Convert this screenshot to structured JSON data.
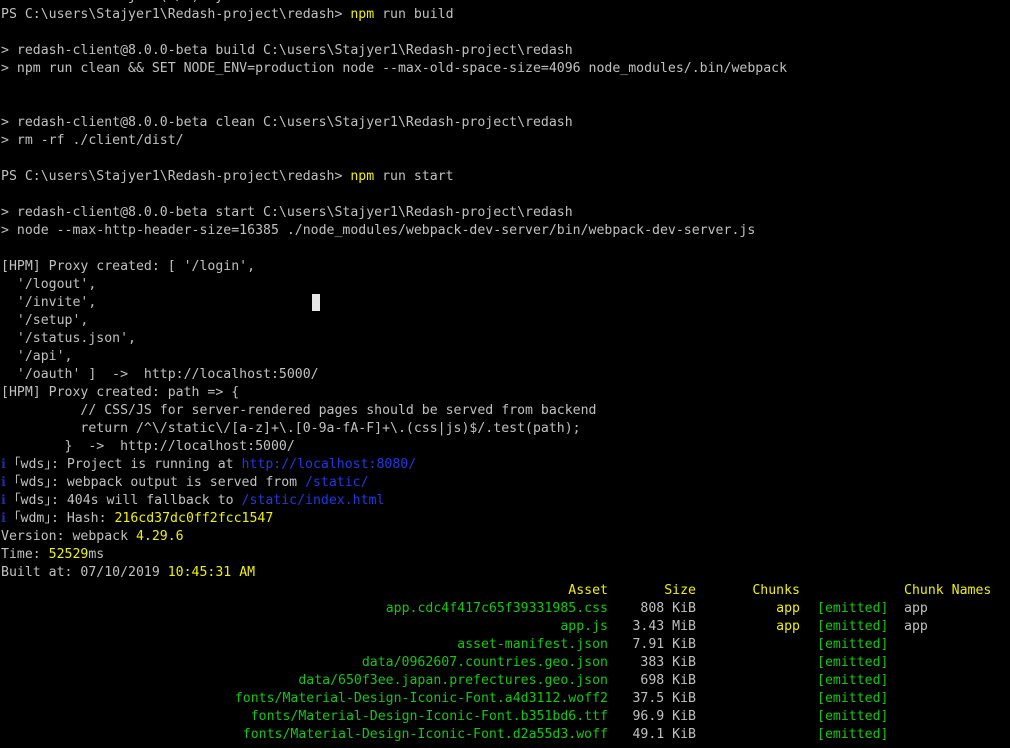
{
  "terminal": {
    "lines": [
      [
        {
          "t": "Terminate batch job (Y/N)? y",
          "c": "w"
        }
      ],
      [
        {
          "t": "PS C:\\users\\Stajyer1\\Redash-project\\redash> ",
          "c": "w"
        },
        {
          "t": "npm",
          "c": "y"
        },
        {
          "t": " run build",
          "c": "w"
        }
      ],
      [],
      [
        {
          "t": "> redash-client@8.0.0-beta build C:\\users\\Stajyer1\\Redash-project\\redash",
          "c": "w"
        }
      ],
      [
        {
          "t": "> npm run clean && SET NODE_ENV=production node --max-old-space-size=4096 node_modules/.bin/webpack",
          "c": "w"
        }
      ],
      [],
      [],
      [
        {
          "t": "> redash-client@8.0.0-beta clean C:\\users\\Stajyer1\\Redash-project\\redash",
          "c": "w"
        }
      ],
      [
        {
          "t": "> rm -rf ./client/dist/",
          "c": "w"
        }
      ],
      [],
      [
        {
          "t": "PS C:\\users\\Stajyer1\\Redash-project\\redash> ",
          "c": "w"
        },
        {
          "t": "npm",
          "c": "y"
        },
        {
          "t": " run start",
          "c": "w"
        }
      ],
      [],
      [
        {
          "t": "> redash-client@8.0.0-beta start C:\\users\\Stajyer1\\Redash-project\\redash",
          "c": "w"
        }
      ],
      [
        {
          "t": "> node --max-http-header-size=16385 ./node_modules/webpack-dev-server/bin/webpack-dev-server.js",
          "c": "w"
        }
      ],
      [],
      [
        {
          "t": "[HPM] Proxy created: [ '/login',",
          "c": "w"
        }
      ],
      [
        {
          "t": "  '/logout',",
          "c": "w"
        }
      ],
      [
        {
          "t": "  '/invite',",
          "c": "w"
        }
      ],
      [
        {
          "t": "  '/setup',",
          "c": "w"
        }
      ],
      [
        {
          "t": "  '/status.json',",
          "c": "w"
        }
      ],
      [
        {
          "t": "  '/api',",
          "c": "w"
        }
      ],
      [
        {
          "t": "  '/oauth' ]  ->  http://localhost:5000/",
          "c": "w"
        }
      ],
      [
        {
          "t": "[HPM] Proxy created: path => {",
          "c": "w"
        }
      ],
      [
        {
          "t": "          // CSS/JS for server-rendered pages should be served from backend",
          "c": "w"
        }
      ],
      [
        {
          "t": "          return /^\\/static\\/[a-z]+\\.[0-9a-fA-F]+\\.(css|js)$/.test(path);",
          "c": "w"
        }
      ],
      [
        {
          "t": "        }  ->  http://localhost:5000/",
          "c": "w"
        }
      ],
      [
        {
          "t": "ℹ ",
          "c": "dk"
        },
        {
          "t": "｢wds｣: Project is running at ",
          "c": "w"
        },
        {
          "t": "http://localhost:8080/",
          "c": "b"
        }
      ],
      [
        {
          "t": "ℹ ",
          "c": "dk"
        },
        {
          "t": "｢wds｣: webpack output is served from ",
          "c": "w"
        },
        {
          "t": "/static/",
          "c": "b"
        }
      ],
      [
        {
          "t": "ℹ ",
          "c": "dk"
        },
        {
          "t": "｢wds｣: 404s will fallback to ",
          "c": "w"
        },
        {
          "t": "/static/index.html",
          "c": "b"
        }
      ],
      [
        {
          "t": "ℹ ",
          "c": "dk"
        },
        {
          "t": "｢wdm｣: Hash: ",
          "c": "w"
        },
        {
          "t": "216cd37dc0ff2fcc1547",
          "c": "y"
        }
      ],
      [
        {
          "t": "Version: webpack ",
          "c": "w"
        },
        {
          "t": "4.29.6",
          "c": "y"
        }
      ],
      [
        {
          "t": "Time: ",
          "c": "w"
        },
        {
          "t": "52529",
          "c": "y"
        },
        {
          "t": "ms",
          "c": "w"
        }
      ],
      [
        {
          "t": "Built at: 07/10/2019 ",
          "c": "w"
        },
        {
          "t": "10:45:31 AM",
          "c": "y"
        }
      ]
    ],
    "table": {
      "headers": {
        "asset": "Asset",
        "size": "Size",
        "chunks": "Chunks",
        "names": "Chunk Names"
      },
      "rows": [
        {
          "asset": "app.cdc4f417c65f39331985.css",
          "size": "808 KiB",
          "chunks": "app",
          "status": "[emitted]",
          "names": "app"
        },
        {
          "asset": "app.js",
          "size": "3.43 MiB",
          "chunks": "app",
          "status": "[emitted]",
          "names": "app"
        },
        {
          "asset": "asset-manifest.json",
          "size": "7.91 KiB",
          "chunks": "",
          "status": "[emitted]",
          "names": ""
        },
        {
          "asset": "data/0962607.countries.geo.json",
          "size": "383 KiB",
          "chunks": "",
          "status": "[emitted]",
          "names": ""
        },
        {
          "asset": "data/650f3ee.japan.prefectures.geo.json",
          "size": "698 KiB",
          "chunks": "",
          "status": "[emitted]",
          "names": ""
        },
        {
          "asset": "fonts/Material-Design-Iconic-Font.a4d3112.woff2",
          "size": "37.5 KiB",
          "chunks": "",
          "status": "[emitted]",
          "names": ""
        },
        {
          "asset": "fonts/Material-Design-Iconic-Font.b351bd6.ttf",
          "size": "96.9 KiB",
          "chunks": "",
          "status": "[emitted]",
          "names": ""
        },
        {
          "asset": "fonts/Material-Design-Iconic-Font.d2a55d3.woff",
          "size": "49.1 KiB",
          "chunks": "",
          "status": "[emitted]",
          "names": ""
        }
      ]
    }
  }
}
